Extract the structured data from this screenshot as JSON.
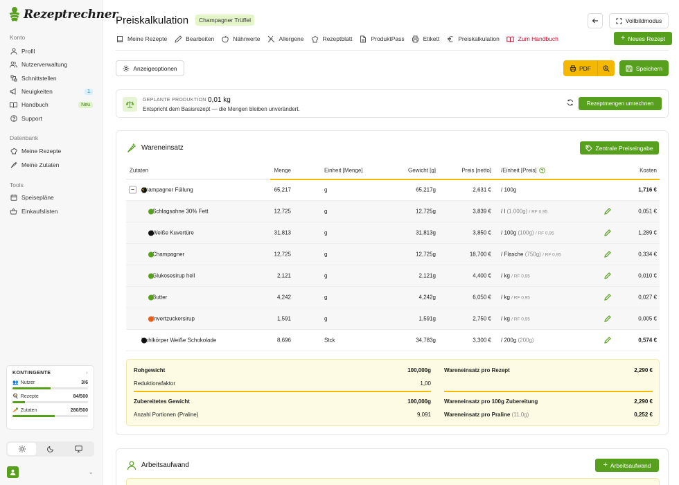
{
  "app": {
    "name": "Rezeptrechner"
  },
  "sidebar": {
    "sections": [
      {
        "title": "Konto",
        "items": [
          {
            "label": "Profil"
          },
          {
            "label": "Nutzerverwaltung"
          },
          {
            "label": "Schnittstellen"
          },
          {
            "label": "Neuigkeiten",
            "badge": "1"
          },
          {
            "label": "Handbuch",
            "badge": "Neu"
          },
          {
            "label": "Support"
          }
        ]
      },
      {
        "title": "Datenbank",
        "items": [
          {
            "label": "Meine Rezepte"
          },
          {
            "label": "Meine Zutaten"
          }
        ]
      },
      {
        "title": "Tools",
        "items": [
          {
            "label": "Speisepläne"
          },
          {
            "label": "Einkaufslisten"
          }
        ]
      }
    ],
    "quota": {
      "title": "KONTINGENTE",
      "rows": [
        {
          "label": "Nutzer",
          "value": "3/6",
          "fraction": 0.5
        },
        {
          "label": "Rezepte",
          "value": "84/500",
          "fraction": 0.168
        },
        {
          "label": "Zutaten",
          "value": "280/500",
          "fraction": 0.56
        }
      ]
    }
  },
  "header": {
    "title": "Preiskalkulation",
    "recipe_tag": "Champagner Trüffel",
    "fullscreen_label": "Vollbildmodus",
    "new_recipe_label": "Neues Rezept"
  },
  "tabs": [
    {
      "label": "Meine Rezepte",
      "icon": "book-icon"
    },
    {
      "label": "Bearbeiten",
      "icon": "pencil-icon"
    },
    {
      "label": "Nährwerte",
      "icon": "apple-icon"
    },
    {
      "label": "Allergene",
      "icon": "wheat-off-icon"
    },
    {
      "label": "Rezeptblatt",
      "icon": "chef-hat-icon"
    },
    {
      "label": "ProduktPass",
      "icon": "document-icon"
    },
    {
      "label": "Etikett",
      "icon": "printer-icon"
    },
    {
      "label": "Preiskalkulation",
      "icon": "euro-icon"
    },
    {
      "label": "Zum Handbuch",
      "icon": "handbook-icon"
    }
  ],
  "toolbar": {
    "view_options_label": "Anzeigeoptionen",
    "pdf_label": "PDF",
    "save_label": "Speichern"
  },
  "production": {
    "label": "GEPLANTE PRODUKTION",
    "value": "0,01 kg",
    "description": "Entspricht dem Basisrezept — die Mengen bleiben unverändert.",
    "convert_label": "Rezeptmengen umrechnen"
  },
  "ware": {
    "title": "Wareneinsatz",
    "price_button": "Zentrale Preiseingabe",
    "columns": {
      "zutaten": "Zutaten",
      "menge": "Menge",
      "einheit": "Einheit [Menge]",
      "gewicht": "Gewicht [g]",
      "preis": "Preis [netto]",
      "per": "/Einheit [Preis]",
      "kosten": "Kosten"
    },
    "rows": [
      {
        "name": "Champagner Füllung",
        "menge": "65,217",
        "einheit": "g",
        "gewicht": "65,217g",
        "preis": "2,631 €",
        "per": "/ 100g",
        "paren": "",
        "rf": "",
        "kosten": "1,716 €",
        "level": 0,
        "collapse": "−",
        "dot": "black",
        "bolt": "⚡",
        "edit": false,
        "bold_kosten": true
      },
      {
        "name": "Schlagsahne 30% Fett",
        "menge": "12,725",
        "einheit": "g",
        "gewicht": "12,725g",
        "preis": "3,839 €",
        "per": "/ l",
        "paren": "(1.000g)",
        "rf": "/ RF 0,95",
        "kosten": "0,051 €",
        "level": 1,
        "dot": "green",
        "edit": true
      },
      {
        "name": "Weiße Kuvertüre",
        "menge": "31,813",
        "einheit": "g",
        "gewicht": "31,813g",
        "preis": "3,850 €",
        "per": "/ 100g",
        "paren": "(100g)",
        "rf": "/ RF 0,95",
        "kosten": "1,289 €",
        "level": 1,
        "dot": "black",
        "edit": true
      },
      {
        "name": "Champagner",
        "menge": "12,725",
        "einheit": "g",
        "gewicht": "12,725g",
        "preis": "18,700 €",
        "per": "/ Flasche",
        "paren": "(750g)",
        "rf": "/ RF 0,95",
        "kosten": "0,334 €",
        "level": 1,
        "dot": "green",
        "edit": true
      },
      {
        "name": "Glukosesirup hell",
        "menge": "2,121",
        "einheit": "g",
        "gewicht": "2,121g",
        "preis": "4,400 €",
        "per": "/ kg",
        "paren": "",
        "rf": "/ RF 0,95",
        "kosten": "0,010 €",
        "level": 1,
        "dot": "green",
        "edit": true
      },
      {
        "name": "Butter",
        "menge": "4,242",
        "einheit": "g",
        "gewicht": "4,242g",
        "preis": "6,050 €",
        "per": "/ kg",
        "paren": "",
        "rf": "/ RF 0,95",
        "kosten": "0,027 €",
        "level": 1,
        "dot": "green",
        "edit": true
      },
      {
        "name": "Invertzuckersirup",
        "menge": "1,591",
        "einheit": "g",
        "gewicht": "1,591g",
        "preis": "2,750 €",
        "per": "/ kg",
        "paren": "",
        "rf": "/ RF 0,95",
        "kosten": "0,005 €",
        "level": 1,
        "dot": "orange",
        "edit": true
      },
      {
        "name": "Hohlkörper Weiße Schokolade",
        "menge": "8,696",
        "einheit": "Stck",
        "gewicht": "34,783g",
        "preis": "3,300 €",
        "per": "/ 200g",
        "paren": "(200g)",
        "rf": "",
        "kosten": "0,574 €",
        "level": 0,
        "dot": "black",
        "edit": true,
        "bold_kosten": true
      }
    ],
    "summary": {
      "left": [
        {
          "label": "Rohgewicht",
          "value": "100,000g",
          "bold": true
        },
        {
          "label": "Reduktionsfaktor",
          "value": "1,00",
          "bold": false
        },
        {
          "label": "Zubereitetes Gewicht",
          "value": "100,000g",
          "bold": true
        },
        {
          "label": "Anzahl Portionen (Praline)",
          "value": "9,091",
          "bold": false
        }
      ],
      "right": [
        {
          "label": "Wareneinsatz pro Rezept",
          "suffix": "",
          "value": "2,290 €"
        },
        {
          "label": "Wareneinsatz pro 100g Zubereitung",
          "suffix": "",
          "value": "2,290 €"
        },
        {
          "label": "Wareneinsatz pro Praline",
          "suffix": "(11,0g)",
          "value": "0,252 €"
        }
      ]
    }
  },
  "arbeit": {
    "title": "Arbeitsaufwand",
    "button": "Arbeitsaufwand"
  },
  "colors": {
    "accent": "#57a01e",
    "highlight": "#f5b800",
    "link_red": "#c8102e"
  }
}
